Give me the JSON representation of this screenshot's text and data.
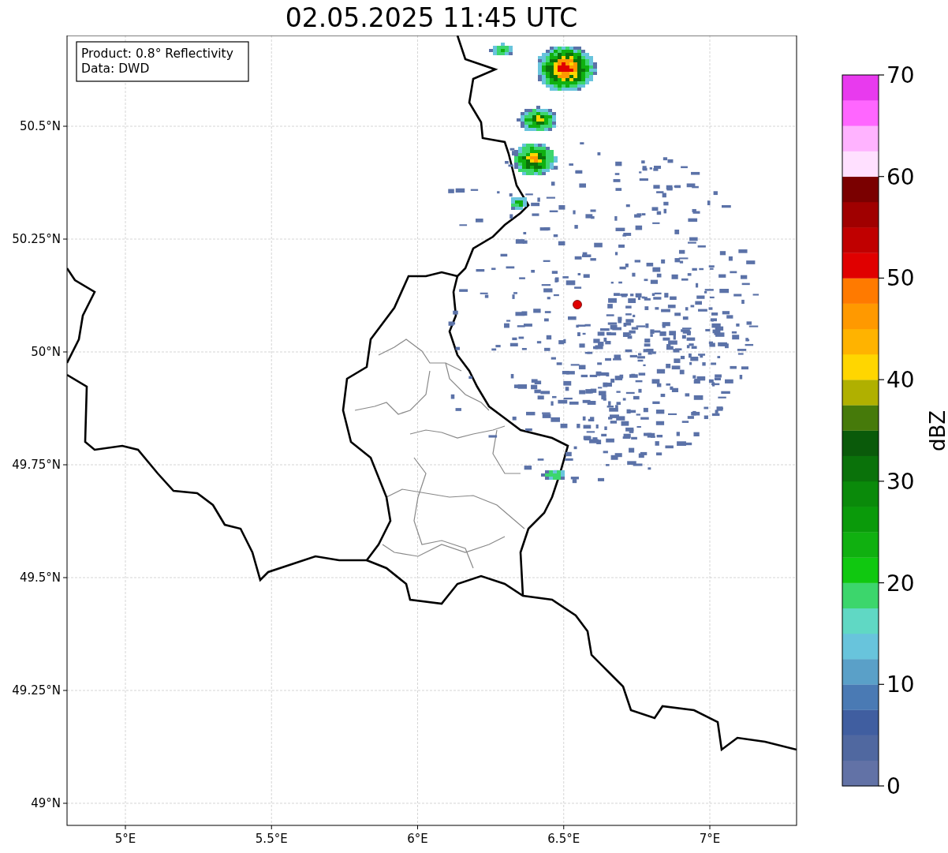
{
  "title": "02.05.2025 11:45 UTC",
  "info_box": {
    "lines": [
      "Product: 0.8° Reflectivity",
      "Data: DWD"
    ]
  },
  "map": {
    "xticks": [
      "5°E",
      "5.5°E",
      "6°E",
      "6.5°E",
      "7°E"
    ],
    "yticks": [
      "50.5°N",
      "50.25°N",
      "50°N",
      "49.75°N",
      "49.5°N",
      "49.25°N",
      "49°N"
    ]
  },
  "colorbar": {
    "label": "dBZ",
    "ticks": [
      "70",
      "60",
      "50",
      "40",
      "30",
      "20",
      "10",
      "0"
    ],
    "bins": [
      {
        "color": "#6272a6"
      },
      {
        "color": "#5068a0"
      },
      {
        "color": "#405ea0"
      },
      {
        "color": "#4a7ab4"
      },
      {
        "color": "#5aa0c8"
      },
      {
        "color": "#68c4dc"
      },
      {
        "color": "#60d8c4"
      },
      {
        "color": "#3cd66c"
      },
      {
        "color": "#10c810"
      },
      {
        "color": "#10b010"
      },
      {
        "color": "#0a9a0a"
      },
      {
        "color": "#0a8a0a"
      },
      {
        "color": "#0a720a"
      },
      {
        "color": "#0a5a0a"
      },
      {
        "color": "#467a0a"
      },
      {
        "color": "#b0b000"
      },
      {
        "color": "#ffd600"
      },
      {
        "color": "#ffb300"
      },
      {
        "color": "#ff9900"
      },
      {
        "color": "#ff7a00"
      },
      {
        "color": "#e00000"
      },
      {
        "color": "#c00000"
      },
      {
        "color": "#a00000"
      },
      {
        "color": "#7a0000"
      },
      {
        "color": "#ffe0ff"
      },
      {
        "color": "#ffb3ff"
      },
      {
        "color": "#ff66ff"
      },
      {
        "color": "#e83aee"
      }
    ]
  }
}
